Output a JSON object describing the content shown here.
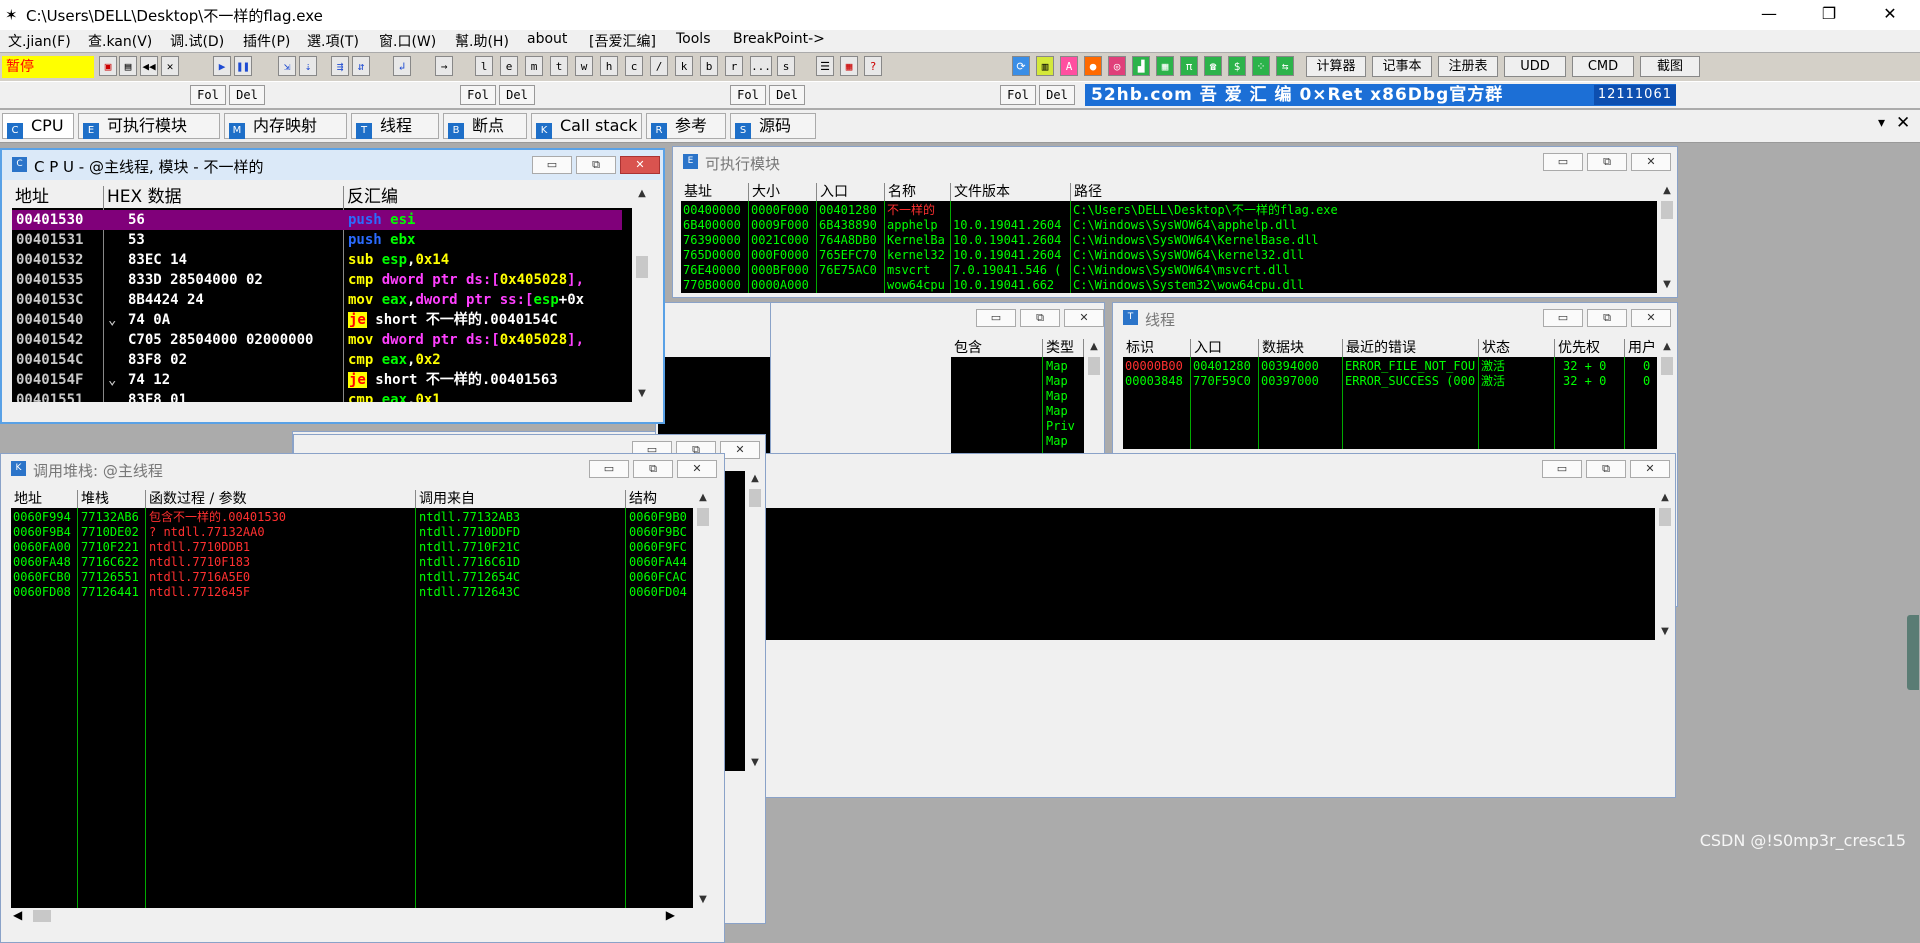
{
  "window": {
    "title": "C:\\Users\\DELL\\Desktop\\不一样的flag.exe",
    "minimize": "—",
    "restore": "❐",
    "close": "✕"
  },
  "menu": [
    "文.jian(F)",
    "查.kan(V)",
    "调.试(D)",
    "插件(P)",
    "選.項(T)",
    "窗.口(W)",
    "幫.助(H)",
    "about",
    "[吾爱汇编]",
    "Tools",
    "BreakPoint->"
  ],
  "toolbar": {
    "status": "暂停",
    "letters": [
      "l",
      "e",
      "m",
      "t",
      "w",
      "h",
      "c",
      "/",
      "k",
      "b",
      "r",
      "...",
      "s"
    ],
    "right_buttons": [
      "计算器",
      "记事本",
      "注册表",
      "UDD",
      "CMD",
      "截图"
    ]
  },
  "toolbar2": {
    "fol": "Fol",
    "del": "Del",
    "banner": "52hb.com  吾 爱 汇 编    0×Ret   x86Dbg官方群",
    "banner_num": "12111061"
  },
  "tabs": [
    {
      "icon": "C",
      "label": "CPU"
    },
    {
      "icon": "E",
      "label": "可执行模块"
    },
    {
      "icon": "M",
      "label": "内存映射"
    },
    {
      "icon": "T",
      "label": "线程"
    },
    {
      "icon": "B",
      "label": "断点"
    },
    {
      "icon": "K",
      "label": "Call stack"
    },
    {
      "icon": "R",
      "label": "参考"
    },
    {
      "icon": "S",
      "label": "源码"
    }
  ],
  "cpu": {
    "title": "C P U  - @主线程, 模块 - 不一样的",
    "headers": [
      "地址",
      "HEX 数据",
      "反汇编"
    ],
    "rows": [
      {
        "addr": "00401530",
        "hex": "56",
        "asm": [
          [
            "b",
            "push "
          ],
          [
            "g",
            "esi"
          ]
        ],
        "sel": true
      },
      {
        "addr": "00401531",
        "hex": "53",
        "asm": [
          [
            "b",
            "push "
          ],
          [
            "g",
            "ebx"
          ]
        ]
      },
      {
        "addr": "00401532",
        "hex": "83EC 14",
        "asm": [
          [
            "y",
            "sub "
          ],
          [
            "g",
            "esp"
          ],
          [
            "ww",
            ","
          ],
          [
            "y",
            "0x14"
          ]
        ]
      },
      {
        "addr": "00401535",
        "hex": "833D 28504000 02",
        "asm": [
          [
            "y",
            "cmp "
          ],
          [
            "m",
            "dword ptr ds:["
          ],
          [
            "y",
            "0x405028"
          ],
          [
            "m",
            "],"
          ]
        ]
      },
      {
        "addr": "0040153C",
        "hex": "8B4424 24",
        "asm": [
          [
            "y",
            "mov "
          ],
          [
            "g",
            "eax"
          ],
          [
            "ww",
            ","
          ],
          [
            "m",
            "dword ptr ss:["
          ],
          [
            "g",
            "esp"
          ],
          [
            "ww",
            "+0x"
          ]
        ]
      },
      {
        "addr": "00401540",
        "hex": "74 0A",
        "asm": [
          [
            "je",
            "je"
          ],
          [
            "ww",
            " short 不一样的.0040154C"
          ]
        ],
        "mark": "⌄"
      },
      {
        "addr": "00401542",
        "hex": "C705 28504000 02000000",
        "asm": [
          [
            "y",
            "mov "
          ],
          [
            "m",
            "dword ptr ds:["
          ],
          [
            "y",
            "0x405028"
          ],
          [
            "m",
            "],"
          ]
        ]
      },
      {
        "addr": "0040154C",
        "hex": "83F8 02",
        "asm": [
          [
            "y",
            "cmp "
          ],
          [
            "g",
            "eax"
          ],
          [
            "ww",
            ","
          ],
          [
            "y",
            "0x2"
          ]
        ]
      },
      {
        "addr": "0040154F",
        "hex": "74 12",
        "asm": [
          [
            "je",
            "je"
          ],
          [
            "ww",
            " short 不一样的.00401563"
          ]
        ],
        "mark": "⌄"
      },
      {
        "addr": "00401551",
        "hex": "83F8 01",
        "asm": [
          [
            "y",
            "cmp "
          ],
          [
            "g",
            "eax"
          ],
          [
            "ww",
            ","
          ],
          [
            "y",
            "0x1"
          ]
        ]
      }
    ]
  },
  "modules": {
    "title": "可执行模块",
    "headers": [
      "基址",
      "大小",
      "入口",
      "名称",
      "文件版本",
      "路径"
    ],
    "rows": [
      [
        "00400000",
        "0000F000",
        "00401280",
        "不一样的",
        "",
        "C:\\Users\\DELL\\Desktop\\不一样的flag.exe"
      ],
      [
        "6B400000",
        "0009F000",
        "6B438890",
        "apphelp",
        "10.0.19041.2604",
        "C:\\Windows\\SysWOW64\\apphelp.dll"
      ],
      [
        "76390000",
        "0021C000",
        "764A8DB0",
        "KernelBa",
        "10.0.19041.2604",
        "C:\\Windows\\SysWOW64\\KernelBase.dll"
      ],
      [
        "765D0000",
        "000F0000",
        "765EFC70",
        "kernel32",
        "10.0.19041.2604",
        "C:\\Windows\\SysWOW64\\kernel32.dll"
      ],
      [
        "76E40000",
        "000BF000",
        "76E75AC0",
        "msvcrt",
        "7.0.19041.546 (",
        "C:\\Windows\\SysWOW64\\msvcrt.dll"
      ],
      [
        "770B0000",
        "0000A000",
        "",
        "wow64cpu",
        "10.0.19041.662",
        "C:\\Windows\\System32\\wow64cpu.dll"
      ]
    ]
  },
  "memory": {
    "headers": [
      "包含",
      "类型"
    ],
    "types": [
      "Map",
      "Map",
      "Map",
      "Map",
      "Priv",
      "Map"
    ]
  },
  "threads": {
    "title": "线程",
    "headers": [
      "标识",
      "入口",
      "数据块",
      "最近的错误",
      "状态",
      "优先权",
      "用户"
    ],
    "rows": [
      [
        "00000B00",
        "00401280",
        "00394000",
        "ERROR_FILE_NOT_FOU",
        "激活",
        "32 + 0",
        "0"
      ],
      [
        "00003848",
        "770F59C0",
        "00397000",
        "ERROR_SUCCESS (000",
        "激活",
        "32 + 0",
        "0"
      ]
    ]
  },
  "callstack": {
    "title": "调用堆栈:    @主线程",
    "headers": [
      "地址",
      "堆栈",
      "函数过程 / 参数",
      "调用来自",
      "结构"
    ],
    "rows": [
      [
        "0060F994",
        "77132AB6",
        "包含不一样的.00401530",
        "ntdll.77132AB3",
        "0060F9B0"
      ],
      [
        "0060F9B4",
        "7710DE02",
        "? ntdll.77132AA0",
        "ntdll.7710DDFD",
        "0060F9BC"
      ],
      [
        "0060FA00",
        "7710F221",
        "ntdll.7710DDB1",
        "ntdll.7710F21C",
        "0060F9FC"
      ],
      [
        "0060FA48",
        "7716C622",
        "ntdll.7710F183",
        "ntdll.7716C61D",
        "0060FA44"
      ],
      [
        "0060FCB0",
        "77126551",
        "ntdll.7716A5E0",
        "ntdll.7712654C",
        "0060FCAC"
      ],
      [
        "0060FD08",
        "77126441",
        "ntdll.7712645F",
        "ntdll.7712643C",
        "0060FD04"
      ]
    ]
  },
  "watermark": "CSDN @!S0mp3r_cresc15"
}
